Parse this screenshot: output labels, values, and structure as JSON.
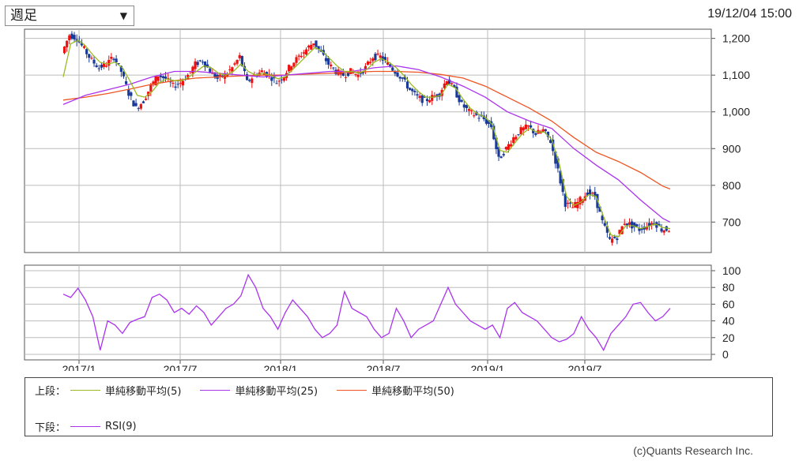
{
  "period_select": {
    "value": "週足",
    "arrow": "▼"
  },
  "timestamp": "19/12/04 15:00",
  "copyright": "(c)Quants Research Inc.",
  "legend": {
    "upper_label": "上段：",
    "lower_label": "下段：",
    "upper": [
      {
        "label": "単純移動平均(5)",
        "color": "#99bb22"
      },
      {
        "label": "単純移動平均(25)",
        "color": "#aa33ee"
      },
      {
        "label": "単純移動平均(50)",
        "color": "#ee5522"
      }
    ],
    "lower": [
      {
        "label": "RSI(9)",
        "color": "#aa33ee"
      }
    ]
  },
  "chart_data": [
    {
      "type": "candlestick",
      "y_ticks": [
        "1,200",
        "1,100",
        "1,000",
        "900",
        "800",
        "700"
      ],
      "ylim": [
        617,
        1225
      ],
      "x_ticks": [
        "2017/1",
        "2017/7",
        "2018/1",
        "2018/7",
        "2019/1",
        "2019/7"
      ],
      "grid": true,
      "up_color": "#ee1111",
      "down_color": "#1a3a99",
      "price_path": [
        [
          0,
          1160
        ],
        [
          1,
          1210
        ],
        [
          2,
          1200
        ],
        [
          3,
          1170
        ],
        [
          4,
          1140
        ],
        [
          5,
          1120
        ],
        [
          6,
          1130
        ],
        [
          7,
          1150
        ],
        [
          8,
          1110
        ],
        [
          9,
          1050
        ],
        [
          10,
          1010
        ],
        [
          11,
          1030
        ],
        [
          12,
          1070
        ],
        [
          13,
          1100
        ],
        [
          14,
          1090
        ],
        [
          15,
          1070
        ],
        [
          16,
          1080
        ],
        [
          17,
          1100
        ],
        [
          18,
          1130
        ],
        [
          19,
          1140
        ],
        [
          20,
          1110
        ],
        [
          21,
          1090
        ],
        [
          22,
          1100
        ],
        [
          23,
          1120
        ],
        [
          24,
          1150
        ],
        [
          25,
          1080
        ],
        [
          26,
          1100
        ],
        [
          27,
          1110
        ],
        [
          28,
          1100
        ],
        [
          29,
          1080
        ],
        [
          30,
          1100
        ],
        [
          31,
          1130
        ],
        [
          32,
          1150
        ],
        [
          33,
          1170
        ],
        [
          34,
          1190
        ],
        [
          35,
          1160
        ],
        [
          36,
          1130
        ],
        [
          37,
          1110
        ],
        [
          38,
          1100
        ],
        [
          39,
          1110
        ],
        [
          40,
          1100
        ],
        [
          41,
          1120
        ],
        [
          42,
          1150
        ],
        [
          43,
          1150
        ],
        [
          44,
          1130
        ],
        [
          45,
          1110
        ],
        [
          46,
          1090
        ],
        [
          47,
          1060
        ],
        [
          48,
          1040
        ],
        [
          49,
          1030
        ],
        [
          50,
          1040
        ],
        [
          51,
          1050
        ],
        [
          52,
          1090
        ],
        [
          53,
          1060
        ],
        [
          54,
          1020
        ],
        [
          55,
          1000
        ],
        [
          56,
          990
        ],
        [
          57,
          980
        ],
        [
          58,
          960
        ],
        [
          59,
          870
        ],
        [
          60,
          900
        ],
        [
          61,
          930
        ],
        [
          62,
          950
        ],
        [
          63,
          960
        ],
        [
          64,
          940
        ],
        [
          65,
          950
        ],
        [
          66,
          920
        ],
        [
          67,
          840
        ],
        [
          68,
          750
        ],
        [
          69,
          740
        ],
        [
          70,
          760
        ],
        [
          71,
          780
        ],
        [
          72,
          770
        ],
        [
          73,
          700
        ],
        [
          74,
          650
        ],
        [
          75,
          660
        ],
        [
          76,
          700
        ],
        [
          77,
          690
        ],
        [
          78,
          680
        ],
        [
          79,
          690
        ],
        [
          80,
          700
        ],
        [
          81,
          680
        ],
        [
          82,
          680
        ]
      ],
      "sma5": [
        [
          0,
          1095
        ],
        [
          1,
          1185
        ],
        [
          2,
          1195
        ],
        [
          3,
          1180
        ],
        [
          4,
          1155
        ],
        [
          5,
          1135
        ],
        [
          6,
          1130
        ],
        [
          7,
          1135
        ],
        [
          8,
          1120
        ],
        [
          9,
          1085
        ],
        [
          10,
          1045
        ],
        [
          11,
          1040
        ],
        [
          12,
          1055
        ],
        [
          13,
          1080
        ],
        [
          14,
          1090
        ],
        [
          15,
          1085
        ],
        [
          16,
          1085
        ],
        [
          17,
          1095
        ],
        [
          18,
          1110
        ],
        [
          19,
          1125
        ],
        [
          20,
          1120
        ],
        [
          21,
          1105
        ],
        [
          22,
          1100
        ],
        [
          23,
          1110
        ],
        [
          24,
          1130
        ],
        [
          25,
          1110
        ],
        [
          26,
          1100
        ],
        [
          27,
          1105
        ],
        [
          28,
          1100
        ],
        [
          29,
          1090
        ],
        [
          30,
          1095
        ],
        [
          31,
          1115
        ],
        [
          32,
          1135
        ],
        [
          33,
          1155
        ],
        [
          34,
          1175
        ],
        [
          35,
          1165
        ],
        [
          36,
          1145
        ],
        [
          37,
          1125
        ],
        [
          38,
          1110
        ],
        [
          39,
          1110
        ],
        [
          40,
          1105
        ],
        [
          41,
          1115
        ],
        [
          42,
          1135
        ],
        [
          43,
          1145
        ],
        [
          44,
          1135
        ],
        [
          45,
          1120
        ],
        [
          46,
          1100
        ],
        [
          47,
          1075
        ],
        [
          48,
          1055
        ],
        [
          49,
          1040
        ],
        [
          50,
          1040
        ],
        [
          51,
          1045
        ],
        [
          52,
          1075
        ],
        [
          53,
          1065
        ],
        [
          54,
          1035
        ],
        [
          55,
          1010
        ],
        [
          56,
          995
        ],
        [
          57,
          985
        ],
        [
          58,
          965
        ],
        [
          59,
          895
        ],
        [
          60,
          890
        ],
        [
          61,
          915
        ],
        [
          62,
          940
        ],
        [
          63,
          955
        ],
        [
          64,
          945
        ],
        [
          65,
          945
        ],
        [
          66,
          925
        ],
        [
          67,
          860
        ],
        [
          68,
          770
        ],
        [
          69,
          745
        ],
        [
          70,
          755
        ],
        [
          71,
          775
        ],
        [
          72,
          770
        ],
        [
          73,
          715
        ],
        [
          74,
          665
        ],
        [
          75,
          660
        ],
        [
          76,
          690
        ],
        [
          77,
          690
        ],
        [
          78,
          682
        ],
        [
          79,
          688
        ],
        [
          80,
          695
        ],
        [
          81,
          685
        ],
        [
          82,
          682
        ]
      ],
      "sma25": [
        [
          0,
          1020
        ],
        [
          3,
          1045
        ],
        [
          6,
          1060
        ],
        [
          9,
          1075
        ],
        [
          12,
          1095
        ],
        [
          15,
          1110
        ],
        [
          18,
          1110
        ],
        [
          21,
          1105
        ],
        [
          24,
          1100
        ],
        [
          27,
          1095
        ],
        [
          30,
          1100
        ],
        [
          33,
          1105
        ],
        [
          36,
          1110
        ],
        [
          39,
          1110
        ],
        [
          42,
          1120
        ],
        [
          45,
          1125
        ],
        [
          48,
          1115
        ],
        [
          51,
          1095
        ],
        [
          54,
          1070
        ],
        [
          57,
          1040
        ],
        [
          60,
          1000
        ],
        [
          63,
          975
        ],
        [
          66,
          955
        ],
        [
          69,
          900
        ],
        [
          72,
          855
        ],
        [
          75,
          815
        ],
        [
          78,
          760
        ],
        [
          81,
          710
        ],
        [
          82,
          700
        ]
      ],
      "sma50": [
        [
          0,
          1032
        ],
        [
          3,
          1040
        ],
        [
          6,
          1050
        ],
        [
          9,
          1062
        ],
        [
          12,
          1075
        ],
        [
          15,
          1085
        ],
        [
          18,
          1092
        ],
        [
          21,
          1095
        ],
        [
          24,
          1098
        ],
        [
          27,
          1100
        ],
        [
          30,
          1100
        ],
        [
          33,
          1103
        ],
        [
          36,
          1105
        ],
        [
          39,
          1108
        ],
        [
          42,
          1110
        ],
        [
          45,
          1110
        ],
        [
          48,
          1108
        ],
        [
          51,
          1102
        ],
        [
          54,
          1092
        ],
        [
          57,
          1070
        ],
        [
          60,
          1040
        ],
        [
          63,
          1010
        ],
        [
          66,
          975
        ],
        [
          69,
          930
        ],
        [
          72,
          890
        ],
        [
          75,
          865
        ],
        [
          78,
          835
        ],
        [
          81,
          798
        ],
        [
          82,
          790
        ]
      ]
    },
    {
      "type": "line",
      "series_name": "RSI(9)",
      "y_ticks": [
        "100",
        "80",
        "60",
        "40",
        "20",
        "0"
      ],
      "ylim": [
        0,
        100
      ],
      "rsi": [
        [
          0,
          72
        ],
        [
          1,
          68
        ],
        [
          2,
          79
        ],
        [
          3,
          65
        ],
        [
          4,
          45
        ],
        [
          5,
          5
        ],
        [
          6,
          40
        ],
        [
          7,
          35
        ],
        [
          8,
          25
        ],
        [
          9,
          38
        ],
        [
          10,
          42
        ],
        [
          11,
          45
        ],
        [
          12,
          68
        ],
        [
          13,
          72
        ],
        [
          14,
          65
        ],
        [
          15,
          50
        ],
        [
          16,
          55
        ],
        [
          17,
          48
        ],
        [
          18,
          58
        ],
        [
          19,
          50
        ],
        [
          20,
          35
        ],
        [
          21,
          45
        ],
        [
          22,
          55
        ],
        [
          23,
          60
        ],
        [
          24,
          70
        ],
        [
          25,
          95
        ],
        [
          26,
          80
        ],
        [
          27,
          55
        ],
        [
          28,
          45
        ],
        [
          29,
          30
        ],
        [
          30,
          50
        ],
        [
          31,
          65
        ],
        [
          32,
          55
        ],
        [
          33,
          45
        ],
        [
          34,
          30
        ],
        [
          35,
          20
        ],
        [
          36,
          25
        ],
        [
          37,
          35
        ],
        [
          38,
          75
        ],
        [
          39,
          55
        ],
        [
          40,
          50
        ],
        [
          41,
          45
        ],
        [
          42,
          30
        ],
        [
          43,
          20
        ],
        [
          44,
          25
        ],
        [
          45,
          55
        ],
        [
          46,
          40
        ],
        [
          47,
          20
        ],
        [
          48,
          30
        ],
        [
          49,
          35
        ],
        [
          50,
          40
        ],
        [
          51,
          60
        ],
        [
          52,
          80
        ],
        [
          53,
          60
        ],
        [
          54,
          50
        ],
        [
          55,
          40
        ],
        [
          56,
          35
        ],
        [
          57,
          30
        ],
        [
          58,
          35
        ],
        [
          59,
          20
        ],
        [
          60,
          55
        ],
        [
          61,
          62
        ],
        [
          62,
          50
        ],
        [
          63,
          45
        ],
        [
          64,
          40
        ],
        [
          65,
          30
        ],
        [
          66,
          20
        ],
        [
          67,
          15
        ],
        [
          68,
          18
        ],
        [
          69,
          25
        ],
        [
          70,
          45
        ],
        [
          71,
          30
        ],
        [
          72,
          20
        ],
        [
          73,
          5
        ],
        [
          74,
          25
        ],
        [
          75,
          35
        ],
        [
          76,
          45
        ],
        [
          77,
          60
        ],
        [
          78,
          62
        ],
        [
          79,
          50
        ],
        [
          80,
          40
        ],
        [
          81,
          45
        ],
        [
          82,
          55
        ]
      ]
    }
  ]
}
